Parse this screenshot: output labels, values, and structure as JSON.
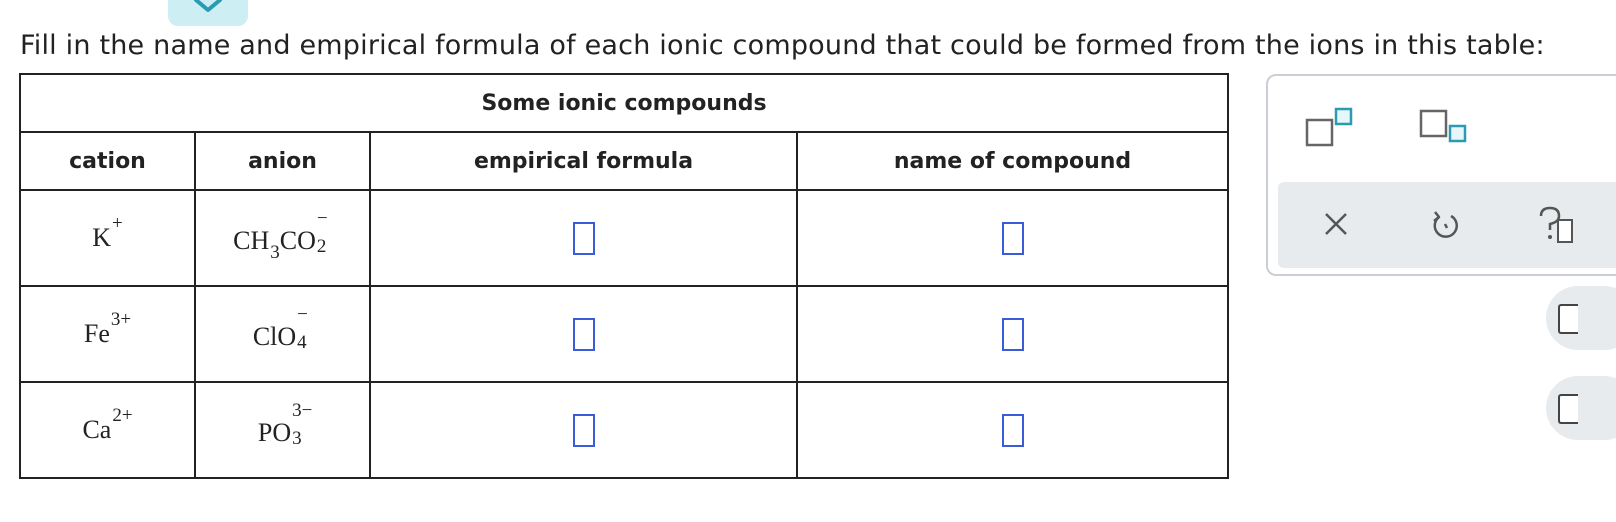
{
  "header": {
    "collapse_icon": "chevron-down-icon"
  },
  "prompt": "Fill in the name and empirical formula of each ionic compound that could be formed from the ions in this table:",
  "table": {
    "caption": "Some ionic compounds",
    "columns": [
      "cation",
      "anion",
      "empirical formula",
      "name of compound"
    ],
    "rows": [
      {
        "cation": {
          "base": "K",
          "charge": "+"
        },
        "anion": {
          "parts": [
            "CH",
            "3",
            "CO",
            "2"
          ],
          "charge": "−"
        }
      },
      {
        "cation": {
          "base": "Fe",
          "charge": "3+"
        },
        "anion": {
          "parts": [
            "ClO",
            "4"
          ],
          "charge": "−"
        }
      },
      {
        "cation": {
          "base": "Ca",
          "charge": "2+"
        },
        "anion": {
          "parts": [
            "PO",
            "3"
          ],
          "charge": "3−"
        }
      }
    ]
  },
  "palette": {
    "tools": [
      "superscript-icon",
      "subscript-icon"
    ],
    "actions": [
      "close-icon",
      "undo-icon",
      "help-icon"
    ]
  },
  "colors": {
    "answer_box": "#3b5bdb",
    "accent": "#2a9bb3",
    "tab": "#cdeef3"
  }
}
